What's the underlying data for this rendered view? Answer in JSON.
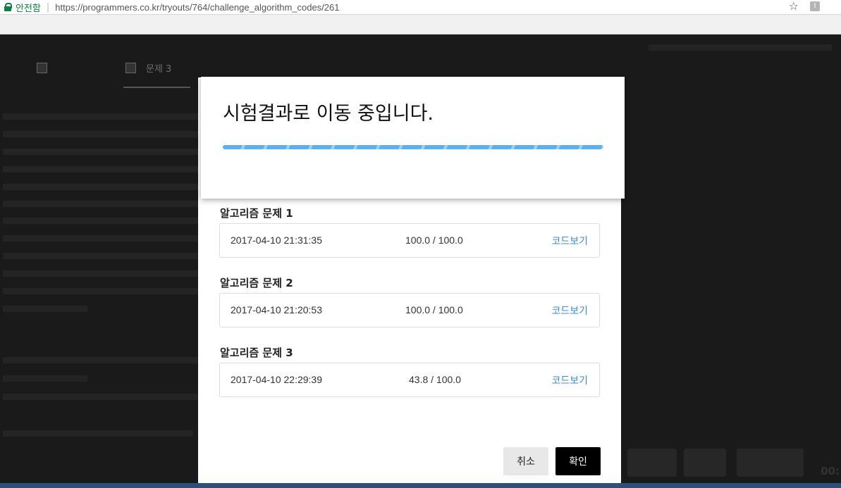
{
  "browser": {
    "secure_label": "안전함",
    "url": "https://programmers.co.kr/tryouts/764/challenge_algorithm_codes/261"
  },
  "modal": {
    "sections": [
      {
        "title": "알고리즘 문제 1",
        "timestamp": "2017-04-10 21:31:35",
        "score": "100.0 / 100.0",
        "link": "코드보기"
      },
      {
        "title": "알고리즘 문제 2",
        "timestamp": "2017-04-10 21:20:53",
        "score": "100.0 / 100.0",
        "link": "코드보기"
      },
      {
        "title": "알고리즘 문제 3",
        "timestamp": "2017-04-10 22:29:39",
        "score": "43.8 / 100.0",
        "link": "코드보기"
      }
    ],
    "cancel_label": "취소",
    "confirm_label": "확인"
  },
  "loading": {
    "title": "시험결과로 이동 중입니다."
  },
  "background": {
    "active_tab": "문제 3"
  },
  "footer": {
    "timer": "00:"
  }
}
